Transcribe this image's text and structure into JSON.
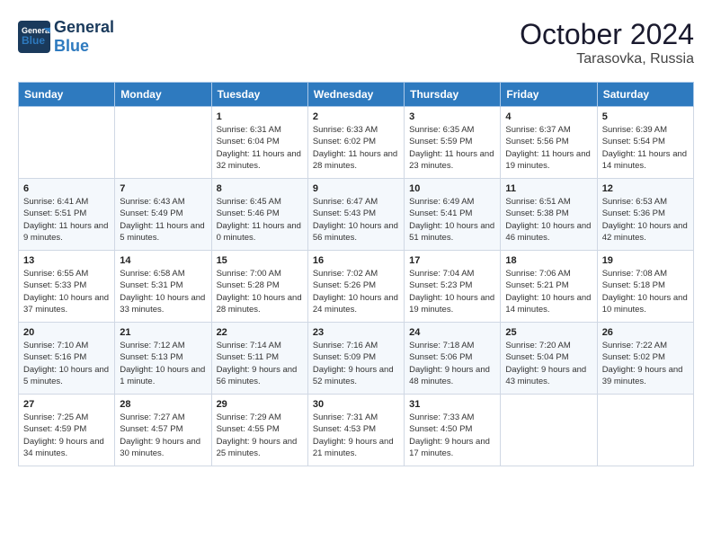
{
  "logo": {
    "general": "General",
    "blue": "Blue"
  },
  "title": "October 2024",
  "subtitle": "Tarasovka, Russia",
  "days_of_week": [
    "Sunday",
    "Monday",
    "Tuesday",
    "Wednesday",
    "Thursday",
    "Friday",
    "Saturday"
  ],
  "weeks": [
    [
      {
        "day": "",
        "info": ""
      },
      {
        "day": "",
        "info": ""
      },
      {
        "day": "1",
        "info": "Sunrise: 6:31 AM\nSunset: 6:04 PM\nDaylight: 11 hours and 32 minutes."
      },
      {
        "day": "2",
        "info": "Sunrise: 6:33 AM\nSunset: 6:02 PM\nDaylight: 11 hours and 28 minutes."
      },
      {
        "day": "3",
        "info": "Sunrise: 6:35 AM\nSunset: 5:59 PM\nDaylight: 11 hours and 23 minutes."
      },
      {
        "day": "4",
        "info": "Sunrise: 6:37 AM\nSunset: 5:56 PM\nDaylight: 11 hours and 19 minutes."
      },
      {
        "day": "5",
        "info": "Sunrise: 6:39 AM\nSunset: 5:54 PM\nDaylight: 11 hours and 14 minutes."
      }
    ],
    [
      {
        "day": "6",
        "info": "Sunrise: 6:41 AM\nSunset: 5:51 PM\nDaylight: 11 hours and 9 minutes."
      },
      {
        "day": "7",
        "info": "Sunrise: 6:43 AM\nSunset: 5:49 PM\nDaylight: 11 hours and 5 minutes."
      },
      {
        "day": "8",
        "info": "Sunrise: 6:45 AM\nSunset: 5:46 PM\nDaylight: 11 hours and 0 minutes."
      },
      {
        "day": "9",
        "info": "Sunrise: 6:47 AM\nSunset: 5:43 PM\nDaylight: 10 hours and 56 minutes."
      },
      {
        "day": "10",
        "info": "Sunrise: 6:49 AM\nSunset: 5:41 PM\nDaylight: 10 hours and 51 minutes."
      },
      {
        "day": "11",
        "info": "Sunrise: 6:51 AM\nSunset: 5:38 PM\nDaylight: 10 hours and 46 minutes."
      },
      {
        "day": "12",
        "info": "Sunrise: 6:53 AM\nSunset: 5:36 PM\nDaylight: 10 hours and 42 minutes."
      }
    ],
    [
      {
        "day": "13",
        "info": "Sunrise: 6:55 AM\nSunset: 5:33 PM\nDaylight: 10 hours and 37 minutes."
      },
      {
        "day": "14",
        "info": "Sunrise: 6:58 AM\nSunset: 5:31 PM\nDaylight: 10 hours and 33 minutes."
      },
      {
        "day": "15",
        "info": "Sunrise: 7:00 AM\nSunset: 5:28 PM\nDaylight: 10 hours and 28 minutes."
      },
      {
        "day": "16",
        "info": "Sunrise: 7:02 AM\nSunset: 5:26 PM\nDaylight: 10 hours and 24 minutes."
      },
      {
        "day": "17",
        "info": "Sunrise: 7:04 AM\nSunset: 5:23 PM\nDaylight: 10 hours and 19 minutes."
      },
      {
        "day": "18",
        "info": "Sunrise: 7:06 AM\nSunset: 5:21 PM\nDaylight: 10 hours and 14 minutes."
      },
      {
        "day": "19",
        "info": "Sunrise: 7:08 AM\nSunset: 5:18 PM\nDaylight: 10 hours and 10 minutes."
      }
    ],
    [
      {
        "day": "20",
        "info": "Sunrise: 7:10 AM\nSunset: 5:16 PM\nDaylight: 10 hours and 5 minutes."
      },
      {
        "day": "21",
        "info": "Sunrise: 7:12 AM\nSunset: 5:13 PM\nDaylight: 10 hours and 1 minute."
      },
      {
        "day": "22",
        "info": "Sunrise: 7:14 AM\nSunset: 5:11 PM\nDaylight: 9 hours and 56 minutes."
      },
      {
        "day": "23",
        "info": "Sunrise: 7:16 AM\nSunset: 5:09 PM\nDaylight: 9 hours and 52 minutes."
      },
      {
        "day": "24",
        "info": "Sunrise: 7:18 AM\nSunset: 5:06 PM\nDaylight: 9 hours and 48 minutes."
      },
      {
        "day": "25",
        "info": "Sunrise: 7:20 AM\nSunset: 5:04 PM\nDaylight: 9 hours and 43 minutes."
      },
      {
        "day": "26",
        "info": "Sunrise: 7:22 AM\nSunset: 5:02 PM\nDaylight: 9 hours and 39 minutes."
      }
    ],
    [
      {
        "day": "27",
        "info": "Sunrise: 7:25 AM\nSunset: 4:59 PM\nDaylight: 9 hours and 34 minutes."
      },
      {
        "day": "28",
        "info": "Sunrise: 7:27 AM\nSunset: 4:57 PM\nDaylight: 9 hours and 30 minutes."
      },
      {
        "day": "29",
        "info": "Sunrise: 7:29 AM\nSunset: 4:55 PM\nDaylight: 9 hours and 25 minutes."
      },
      {
        "day": "30",
        "info": "Sunrise: 7:31 AM\nSunset: 4:53 PM\nDaylight: 9 hours and 21 minutes."
      },
      {
        "day": "31",
        "info": "Sunrise: 7:33 AM\nSunset: 4:50 PM\nDaylight: 9 hours and 17 minutes."
      },
      {
        "day": "",
        "info": ""
      },
      {
        "day": "",
        "info": ""
      }
    ]
  ]
}
